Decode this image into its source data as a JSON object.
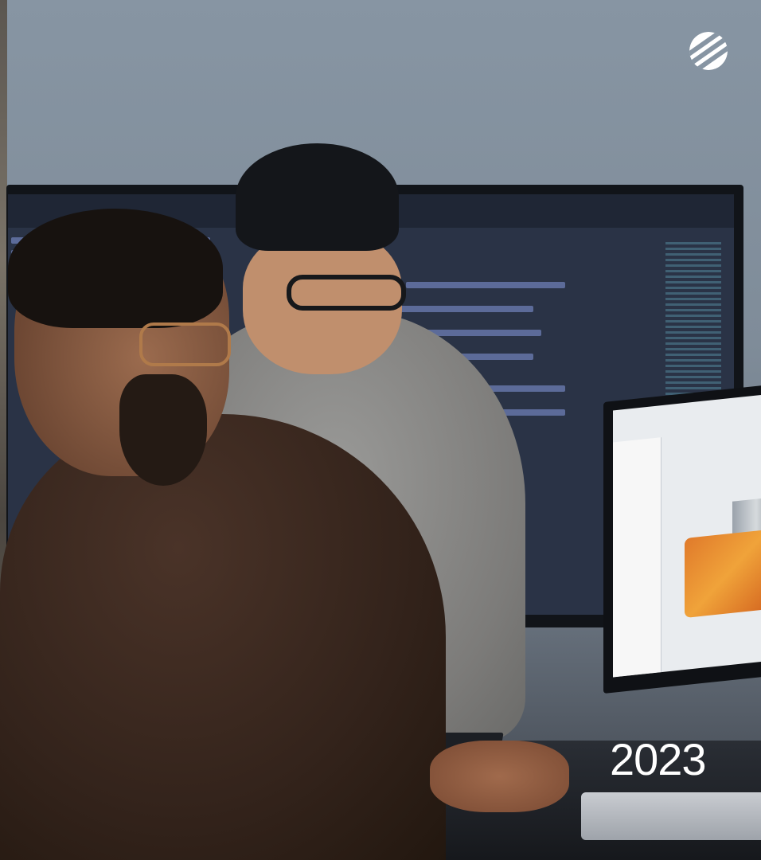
{
  "photo": {
    "year_label": "2023",
    "logo_icon": "striped-circle-logo"
  },
  "colors": {
    "wall": "#7f8c99",
    "code_screen": "#2a3346",
    "cad_orange": "#e07a2b",
    "text": "#ffffff"
  }
}
